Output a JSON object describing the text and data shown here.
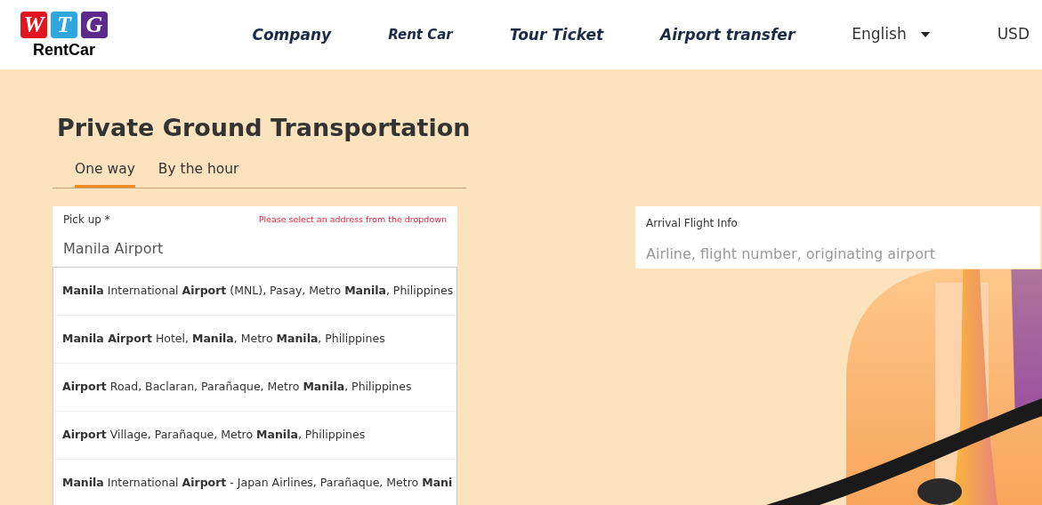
{
  "logo": {
    "letters": [
      {
        "text": "W",
        "color": "#e2141f"
      },
      {
        "text": "T",
        "color": "#2ea6df"
      },
      {
        "text": "G",
        "color": "#5c2a8c"
      }
    ],
    "wordmark": "RentCar"
  },
  "nav": {
    "items": [
      "Company",
      "Rent Car",
      "Tour Ticket",
      "Airport transfer"
    ],
    "language": "English",
    "currency": "USD"
  },
  "title": "Private Ground Transportation",
  "tabs": [
    {
      "label": "One way",
      "selected": true
    },
    {
      "label": "By the hour",
      "selected": false
    }
  ],
  "pickup": {
    "label": "Pick up *",
    "error": "Please select an address from the dropdown",
    "value": "Manila Airport"
  },
  "suggestions": [
    "**Manila** International **Airport** (MNL), Pasay, Metro **Manila**, Philippines",
    "**Manila Airport** Hotel, **Manila**, Metro **Manila**, Philippines",
    "**Airport** Road, Baclaran, Parañaque, Metro **Manila**, Philippines",
    "**Airport** Village, Parañaque, Metro **Manila**, Philippines",
    "**Manila** International **Airport** - Japan Airlines, Parañaque, Metro **Mani**"
  ],
  "arrival": {
    "label": "Arrival Flight Info",
    "placeholder": "Airline, flight number, originating airport"
  }
}
